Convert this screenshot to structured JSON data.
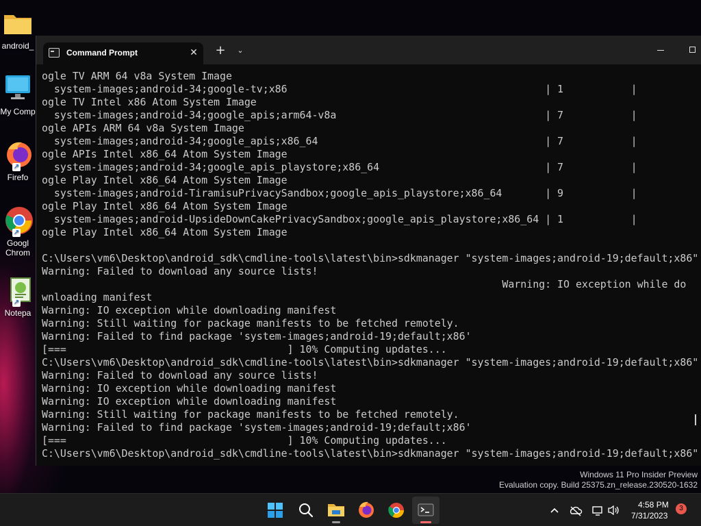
{
  "desktop": {
    "icons": [
      {
        "name": "desktop-icon-android-folder",
        "label": "android_"
      },
      {
        "name": "desktop-icon-my-computer",
        "label": "My Comp"
      },
      {
        "name": "desktop-icon-firefox",
        "label": "Firefo"
      },
      {
        "name": "desktop-icon-chrome",
        "label_line1": "Googl",
        "label_line2": "Chrom"
      },
      {
        "name": "desktop-icon-notepad",
        "label": "Notepa"
      }
    ]
  },
  "terminal": {
    "tab_title": "Command Prompt",
    "lines": [
      "ogle TV ARM 64 v8a System Image",
      "  system-images;android-34;google-tv;x86                                          | 1           |",
      "ogle TV Intel x86 Atom System Image",
      "  system-images;android-34;google_apis;arm64-v8a                                  | 7           |",
      "ogle APIs ARM 64 v8a System Image",
      "  system-images;android-34;google_apis;x86_64                                     | 7           |",
      "ogle APIs Intel x86_64 Atom System Image",
      "  system-images;android-34;google_apis_playstore;x86_64                           | 7           |",
      "ogle Play Intel x86_64 Atom System Image",
      "  system-images;android-TiramisuPrivacySandbox;google_apis_playstore;x86_64       | 9           |",
      "ogle Play Intel x86_64 Atom System Image",
      "  system-images;android-UpsideDownCakePrivacySandbox;google_apis_playstore;x86_64 | 1           |",
      "ogle Play Intel x86_64 Atom System Image",
      "",
      "C:\\Users\\vm6\\Desktop\\android_sdk\\cmdline-tools\\latest\\bin>sdkmanager \"system-images;android-19;default;x86\"",
      "Warning: Failed to download any source lists!",
      "                                                                           Warning: IO exception while do",
      "wnloading manifest",
      "Warning: IO exception while downloading manifest",
      "Warning: Still waiting for package manifests to be fetched remotely.",
      "Warning: Failed to find package 'system-images;android-19;default;x86'",
      "[===                                    ] 10% Computing updates...",
      "C:\\Users\\vm6\\Desktop\\android_sdk\\cmdline-tools\\latest\\bin>sdkmanager \"system-images;android-19;default;x86\"",
      "Warning: Failed to download any source lists!",
      "Warning: IO exception while downloading manifest",
      "Warning: IO exception while downloading manifest",
      "Warning: Still waiting for package manifests to be fetched remotely.",
      "Warning: Failed to find package 'system-images;android-19;default;x86'",
      "[===                                    ] 10% Computing updates...",
      "C:\\Users\\vm6\\Desktop\\android_sdk\\cmdline-tools\\latest\\bin>sdkmanager \"system-images;android-19;default;x86\""
    ]
  },
  "watermark": {
    "line1": "Windows 11 Pro Insider Preview",
    "line2": "Evaluation copy. Build 25375.zn_release.230520-1632"
  },
  "taskbar": {
    "time": "4:58 PM",
    "date": "7/31/2023",
    "notification_count": "3"
  },
  "colors": {
    "terminal_bg": "#0c0c0c",
    "terminal_text": "#cccccc",
    "titlebar_bg": "#202020",
    "taskbar_bg": "#1c1c1c",
    "badge": "#e8584c"
  }
}
